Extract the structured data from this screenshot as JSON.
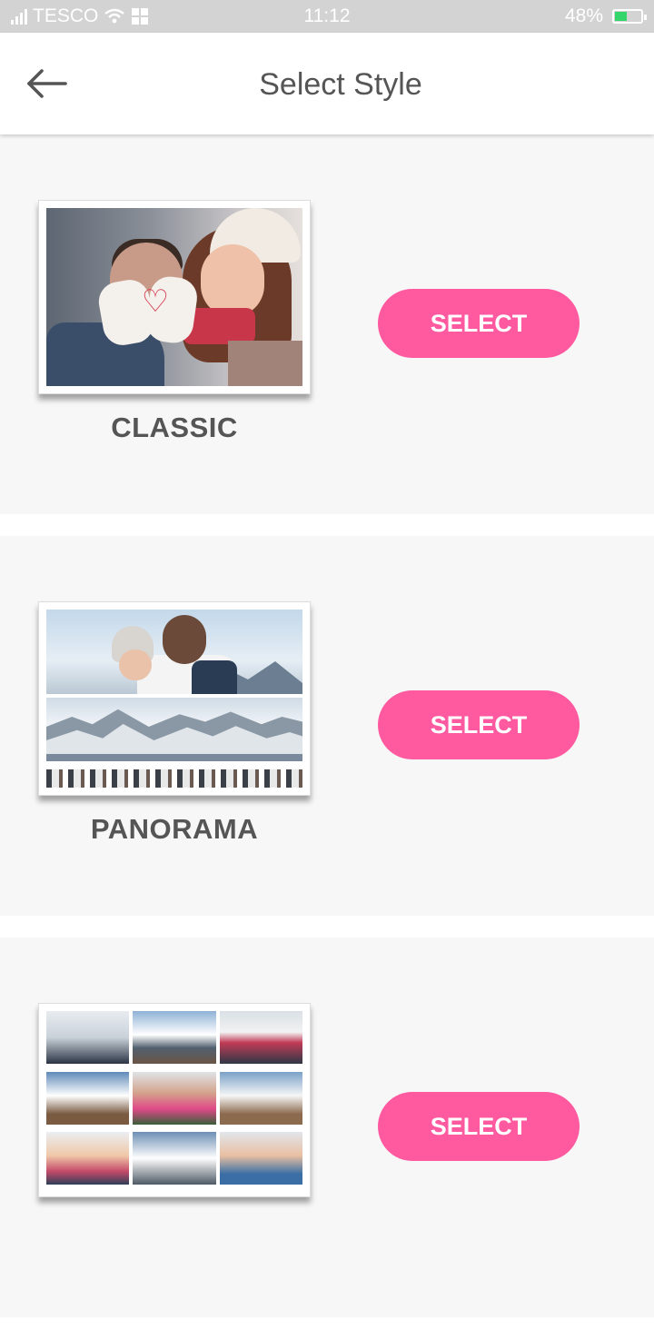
{
  "status_bar": {
    "carrier": "TESCO",
    "time": "11:12",
    "battery_percent": "48%",
    "battery_level": 0.48,
    "battery_color": "#34d56b",
    "background": "#d3d3d3"
  },
  "app_bar": {
    "back_icon": "arrow-left-icon",
    "title": "Select Style"
  },
  "accent_color": "#ff59a0",
  "styles": [
    {
      "name": "CLASSIC",
      "select_label": "SELECT",
      "thumbnail": "couple-winter-photo"
    },
    {
      "name": "PANORAMA",
      "select_label": "SELECT",
      "thumbnail": "panorama-mountain-photo"
    },
    {
      "name": "",
      "select_label": "SELECT",
      "thumbnail": "photo-grid-collage"
    }
  ]
}
